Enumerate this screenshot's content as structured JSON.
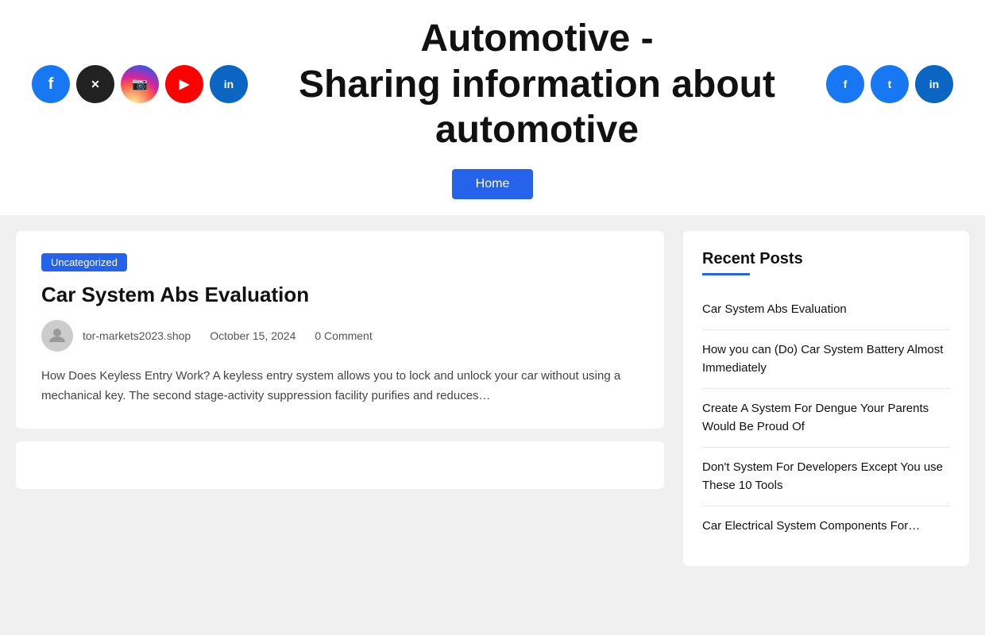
{
  "header": {
    "site_title": "Automotive -",
    "site_subtitle": "Sharing information about automotive"
  },
  "nav": {
    "home_label": "Home"
  },
  "social_left": [
    {
      "id": "facebook",
      "label": "f",
      "class": "icon-facebook"
    },
    {
      "id": "twitter",
      "label": "𝕏",
      "class": "icon-twitter"
    },
    {
      "id": "instagram",
      "label": "📷",
      "class": "icon-instagram"
    },
    {
      "id": "youtube",
      "label": "▶",
      "class": "icon-youtube"
    },
    {
      "id": "linkedin",
      "label": "in",
      "class": "icon-linkedin"
    }
  ],
  "social_right": [
    {
      "id": "fb-right",
      "label": "f",
      "class": "icon-fb-right"
    },
    {
      "id": "tw-right",
      "label": "t",
      "class": "icon-tw-right"
    },
    {
      "id": "li-right",
      "label": "in",
      "class": "icon-li-right"
    }
  ],
  "article": {
    "category": "Uncategorized",
    "title": "Car System Abs Evaluation",
    "author": "tor-markets2023.shop",
    "date": "October 15, 2024",
    "comments": "0 Comment",
    "excerpt": "How Does Keyless Entry Work? A keyless entry system allows you to lock and unlock your car without using a mechanical key. The second stage-activity suppression facility purifies and reduces…"
  },
  "sidebar": {
    "recent_posts_title": "Recent Posts",
    "posts": [
      {
        "id": 1,
        "title": "Car System Abs Evaluation"
      },
      {
        "id": 2,
        "title": "How you can (Do) Car System Battery Almost Immediately"
      },
      {
        "id": 3,
        "title": "Create A System For Dengue Your Parents Would Be Proud Of"
      },
      {
        "id": 4,
        "title": "Don't System For Developers Except You use These 10 Tools"
      },
      {
        "id": 5,
        "title": "Car Electrical System Components For…"
      }
    ]
  }
}
